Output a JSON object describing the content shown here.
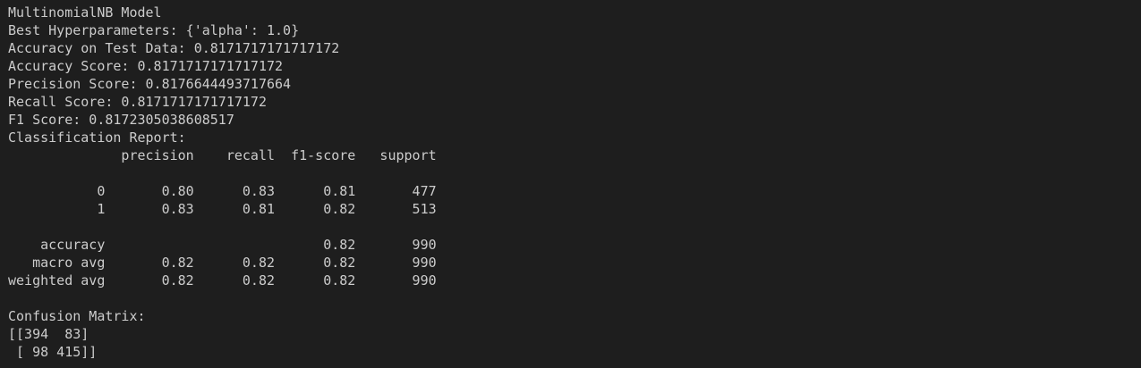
{
  "terminal": {
    "lines": [
      "MultinomialNB Model",
      "Best Hyperparameters: {'alpha': 1.0}",
      "Accuracy on Test Data: 0.8171717171717172",
      "Accuracy Score: 0.8171717171717172",
      "Precision Score: 0.8176644493717664",
      "Recall Score: 0.8171717171717172",
      "F1 Score: 0.8172305038608517",
      "Classification Report:",
      "              precision    recall  f1-score   support",
      "",
      "           0       0.80      0.83      0.81       477",
      "           1       0.83      0.81      0.82       513",
      "",
      "    accuracy                           0.82       990",
      "   macro avg       0.82      0.82      0.82       990",
      "weighted avg       0.82      0.82      0.82       990",
      "",
      "Confusion Matrix:",
      "[[394  83]",
      " [ 98 415]]"
    ]
  },
  "colors": {
    "background": "#1e1e1e",
    "text": "#cccccc"
  }
}
